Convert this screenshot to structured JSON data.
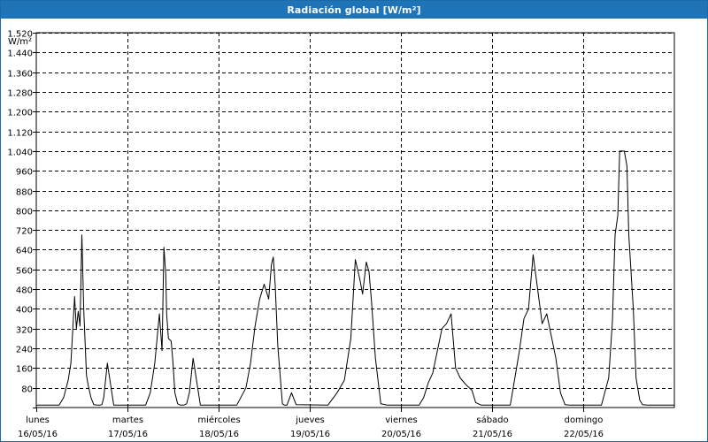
{
  "window": {
    "title": "Radiación global [W/m²]"
  },
  "colors": {
    "titlebar": "#1f74b8",
    "line": "#000000",
    "grid": "#000000",
    "background": "#ffffff"
  },
  "chart_data": {
    "type": "line",
    "title": "Radiación global [W/m²]",
    "ylabel": "W/m²",
    "xlabel": "",
    "ylim": [
      0,
      1520
    ],
    "yticks": [
      {
        "value": 80,
        "label": "80"
      },
      {
        "value": 160,
        "label": "160"
      },
      {
        "value": 240,
        "label": "240"
      },
      {
        "value": 320,
        "label": "320"
      },
      {
        "value": 400,
        "label": "400"
      },
      {
        "value": 480,
        "label": "480"
      },
      {
        "value": 560,
        "label": "560"
      },
      {
        "value": 640,
        "label": "640"
      },
      {
        "value": 720,
        "label": "720"
      },
      {
        "value": 800,
        "label": "800"
      },
      {
        "value": 880,
        "label": "880"
      },
      {
        "value": 960,
        "label": "960"
      },
      {
        "value": 1040,
        "label": "1.040"
      },
      {
        "value": 1120,
        "label": "1.120"
      },
      {
        "value": 1200,
        "label": "1.200"
      },
      {
        "value": 1280,
        "label": "1.280"
      },
      {
        "value": 1360,
        "label": "1.360"
      },
      {
        "value": 1440,
        "label": "1.440"
      },
      {
        "value": 1520,
        "label": "1.520"
      }
    ],
    "xticks": [
      {
        "day": "lunes",
        "date": "16/05/16"
      },
      {
        "day": "martes",
        "date": "17/05/16"
      },
      {
        "day": "miércoles",
        "date": "18/05/16"
      },
      {
        "day": "jueves",
        "date": "19/05/16"
      },
      {
        "day": "viernes",
        "date": "20/05/16"
      },
      {
        "day": "sábado",
        "date": "21/05/16"
      },
      {
        "day": "domingo",
        "date": "22/05/16"
      }
    ],
    "grid": true,
    "series": [
      {
        "x_days": [
          0,
          0.25,
          0.3,
          0.35,
          0.38,
          0.42,
          0.44,
          0.46,
          0.48,
          0.5,
          0.52,
          0.55,
          0.57,
          0.6,
          0.63,
          0.67,
          0.7,
          0.72,
          0.74,
          0.78,
          0.85,
          1.2,
          1.25,
          1.3,
          1.35,
          1.38,
          1.4,
          1.42,
          1.43,
          1.45,
          1.48,
          1.5,
          1.52,
          1.55,
          1.58,
          1.62,
          1.65,
          1.68,
          1.72,
          1.8,
          2.2,
          2.3,
          2.35,
          2.37,
          2.4,
          2.45,
          2.5,
          2.55,
          2.58,
          2.6,
          2.62,
          2.65,
          2.7,
          2.72,
          2.75,
          2.8,
          2.85,
          3.2,
          3.3,
          3.38,
          3.45,
          3.5,
          3.55,
          3.58,
          3.62,
          3.65,
          3.68,
          3.72,
          3.78,
          3.85,
          4.2,
          4.25,
          4.3,
          4.35,
          4.45,
          4.5,
          4.55,
          4.6,
          4.65,
          4.72,
          4.78,
          4.82,
          4.88,
          4.92,
          5.2,
          5.25,
          5.3,
          5.35,
          5.4,
          5.45,
          5.55,
          5.6,
          5.7,
          5.75,
          5.8,
          5.85,
          6.2,
          6.28,
          6.32,
          6.35,
          6.38,
          6.4,
          6.45,
          6.48,
          6.5,
          6.55,
          6.58,
          6.62,
          6.65,
          6.7,
          6.72,
          6.8,
          7.0
        ],
        "y": [
          10,
          10,
          40,
          110,
          180,
          450,
          320,
          390,
          330,
          700,
          400,
          130,
          90,
          40,
          12,
          10,
          10,
          12,
          40,
          180,
          10,
          10,
          60,
          180,
          380,
          230,
          650,
          540,
          380,
          280,
          270,
          180,
          60,
          15,
          10,
          10,
          15,
          60,
          200,
          10,
          10,
          80,
          180,
          240,
          330,
          440,
          500,
          440,
          580,
          610,
          500,
          250,
          15,
          10,
          10,
          60,
          12,
          10,
          60,
          110,
          280,
          600,
          520,
          460,
          590,
          550,
          420,
          200,
          15,
          10,
          10,
          40,
          100,
          140,
          320,
          340,
          380,
          160,
          120,
          90,
          70,
          20,
          10,
          10,
          10,
          120,
          230,
          360,
          400,
          620,
          340,
          380,
          200,
          60,
          12,
          10,
          10,
          120,
          350,
          700,
          780,
          1040,
          1040,
          980,
          700,
          400,
          120,
          30,
          12,
          10,
          10,
          10,
          10
        ]
      }
    ]
  }
}
